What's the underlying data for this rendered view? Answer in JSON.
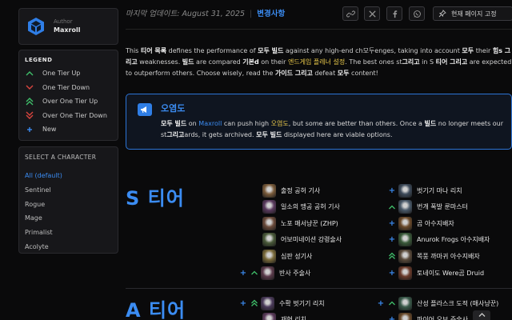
{
  "author": {
    "label": "Author",
    "name": "Maxroll"
  },
  "legend": {
    "title": "LEGEND",
    "items": [
      {
        "label": "One Tier Up",
        "icon": "chevron-up-icon",
        "color": "#3fbf6a"
      },
      {
        "label": "One Tier Down",
        "icon": "chevron-down-icon",
        "color": "#d9443e"
      },
      {
        "label": "Over One Tier Up",
        "icon": "double-chevron-up-icon",
        "color": "#3fbf6a"
      },
      {
        "label": "Over One Tier Down",
        "icon": "double-chevron-down-icon",
        "color": "#d9443e"
      },
      {
        "label": "New",
        "icon": "plus-icon",
        "color": "#3b8cf2"
      }
    ]
  },
  "character_select": {
    "title": "SELECT A CHARACTER",
    "items": [
      "All (default)",
      "Sentinel",
      "Rogue",
      "Mage",
      "Primalist",
      "Acolyte"
    ],
    "active": "All (default)"
  },
  "header": {
    "updated_label": "마지막 업데이트:",
    "updated_date": "August 31, 2025",
    "separator": "|",
    "changelog": "변경사항",
    "share_icons": [
      "link-icon",
      "x-icon",
      "facebook-icon",
      "whatsapp-icon"
    ],
    "copy_label": "현재 페이지 고정"
  },
  "intro": {
    "p1": "This ",
    "p2": "티어 목록",
    "p3": " defines the performance of ",
    "p4": "모두 빌드",
    "p5": " against any high-end ch모두enges, taking into account ",
    "p6": "모두",
    "p7": " their ",
    "p8": "힘s 그리고",
    "p9": " weaknesses. ",
    "p10": "빌드",
    "p11": " are compared ",
    "p12": "기본d",
    "p13": " on their ",
    "p14": "엔드게임 플레너 설정",
    "p15": ". The best ones st",
    "p16": "그리고",
    "p17": " in S ",
    "p18": "티어 그리고",
    "p19": " are expected to outperform others. Choose wisely, read the ",
    "p20": "가이드 그리고",
    "p21": " defeat ",
    "p22": "모두",
    "p23": " content!"
  },
  "callout": {
    "title": "오염도",
    "b1": "모두 빌드",
    "b2": " on ",
    "b3": "Maxroll",
    "b4": " can push high ",
    "b5": "오염도",
    "b6": ", but some are better than others. Once a ",
    "b7": "빌드",
    "b8": " no longer meets our st",
    "b9": "그리고",
    "b10": "ards, it gets archived. ",
    "b11": "모두 빌드",
    "b12": " displayed here are viable options."
  },
  "tiers": [
    {
      "label": "S 티어",
      "builds": [
        {
          "name": "출정 공허 기사",
          "mark": "",
          "color": "#7a5b3a"
        },
        {
          "name": "벗기기 마나 리치",
          "mark": "new",
          "color": "#3d4a5a"
        },
        {
          "name": "일소의 맹공 공허 기사",
          "mark": "",
          "color": "#5a3a5e"
        },
        {
          "name": "번개 폭발 룬마스터",
          "mark": "up",
          "color": "#4a5a6a"
        },
        {
          "name": "노포 매서냥꾼 (ZHP)",
          "mark": "",
          "color": "#6a4a3a"
        },
        {
          "name": "곰 아수지배자",
          "mark": "new",
          "color": "#6b4a2a"
        },
        {
          "name": "어보미네이션 강령술사",
          "mark": "",
          "color": "#4a5a3a"
        },
        {
          "name": "Anurok Frogs 아수지배자",
          "mark": "new",
          "color": "#3a5a3a"
        },
        {
          "name": "심판 성기사",
          "mark": "",
          "color": "#7a6a3a"
        },
        {
          "name": "쪽풍 까마귀 아수지배자",
          "mark": "upup",
          "color": "#5a4a3a"
        },
        {
          "name": "반사 주술사",
          "mark": "newup",
          "color": "#5a3a4a"
        },
        {
          "name": "토네이도 Were곰 Druid",
          "mark": "new",
          "color": "#6a3a2a"
        }
      ]
    },
    {
      "label": "A 티어",
      "builds": [
        {
          "name": "수확 벗기기 리치",
          "mark": "newupup",
          "color": "#4a3a5a"
        },
        {
          "name": "산성 플라스크 도적 (매사냥꾼)",
          "mark": "newup",
          "color": "#3a5a4a"
        },
        {
          "name": "재현 리치",
          "mark": "",
          "color": "#5a3a5a"
        },
        {
          "name": "파이어 오브 주술사",
          "mark": "new",
          "color": "#6a4a2a"
        }
      ]
    }
  ]
}
